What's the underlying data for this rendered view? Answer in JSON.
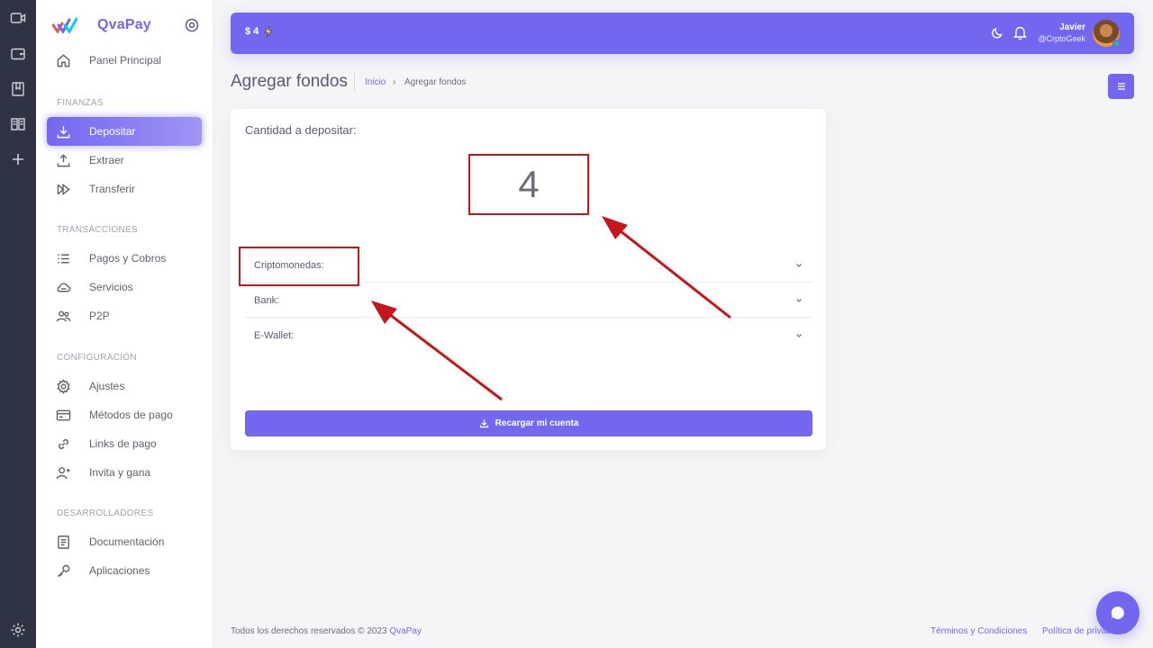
{
  "brand": {
    "name": "QvaPay"
  },
  "sidebar": {
    "sections": [
      {
        "title": "",
        "items": [
          {
            "label": "Panel Principal",
            "icon": "home-icon"
          }
        ]
      },
      {
        "title": "FINANZAS",
        "items": [
          {
            "label": "Depositar",
            "icon": "download-icon",
            "active": true
          },
          {
            "label": "Extraer",
            "icon": "upload-icon"
          },
          {
            "label": "Transferir",
            "icon": "transfer-icon"
          }
        ]
      },
      {
        "title": "TRANSACCIONES",
        "items": [
          {
            "label": "Pagos y Cobros",
            "icon": "list-icon"
          },
          {
            "label": "Servicios",
            "icon": "cloud-icon"
          },
          {
            "label": "P2P",
            "icon": "users-icon"
          }
        ]
      },
      {
        "title": "CONFIGURACIÓN",
        "items": [
          {
            "label": "Ajustes",
            "icon": "gear-icon"
          },
          {
            "label": "Métodos de pago",
            "icon": "card-icon"
          },
          {
            "label": "Links de pago",
            "icon": "link-icon"
          },
          {
            "label": "Invita y gana",
            "icon": "user-plus-icon"
          }
        ]
      },
      {
        "title": "DESARROLLADORES",
        "items": [
          {
            "label": "Documentación",
            "icon": "doc-icon"
          },
          {
            "label": "Aplicaciones",
            "icon": "key-icon"
          }
        ]
      }
    ]
  },
  "topbar": {
    "balance": "$ 4",
    "user_name": "Javier",
    "user_handle": "@CrptoGeek"
  },
  "header": {
    "title": "Agregar fondos",
    "breadcrumb_home": "Inicio",
    "breadcrumb_current": "Agregar fondos"
  },
  "card": {
    "amount_label": "Cantidad a depositar:",
    "amount_value": "4",
    "accordions": [
      {
        "label": "Criptomonedas:"
      },
      {
        "label": "Bank:"
      },
      {
        "label": "E-Wallet:"
      }
    ],
    "submit_label": "Recargar mi cuenta"
  },
  "footer": {
    "copyright": "Todos los derechos reservados © 2023",
    "brand_link": "QvaPay",
    "terms": "Términos y Condiciones",
    "privacy": "Política de privacidad"
  },
  "colors": {
    "accent": "#7367f0",
    "annotation": "#c4161c",
    "rail": "#2e3443"
  }
}
